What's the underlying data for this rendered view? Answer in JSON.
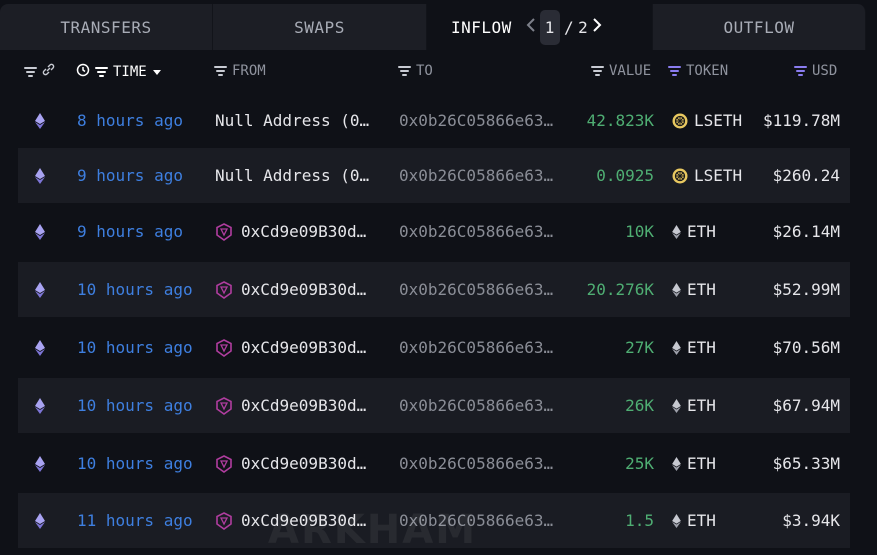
{
  "tabs": [
    {
      "label": "TRANSFERS"
    },
    {
      "label": "SWAPS"
    },
    {
      "label": "INFLOW"
    },
    {
      "label": "OUTFLOW"
    }
  ],
  "pager": {
    "current": "1",
    "separator": "/",
    "total": "2"
  },
  "columns": {
    "time": "TIME",
    "from": "FROM",
    "to": "TO",
    "value": "VALUE",
    "token": "TOKEN",
    "usd": "USD"
  },
  "rows": [
    {
      "time": "8 hours ago",
      "from": "Null Address (0…",
      "to": "0x0b26C05866e63…",
      "value": "42.823K",
      "token": "LSETH",
      "usd": "$119.78M"
    },
    {
      "time": "9 hours ago",
      "from": "Null Address (0…",
      "to": "0x0b26C05866e63…",
      "value": "0.0925",
      "token": "LSETH",
      "usd": "$260.24"
    },
    {
      "time": "9 hours ago",
      "from": "0xCd9e09B30d…",
      "to": "0x0b26C05866e63…",
      "value": "10K",
      "token": "ETH",
      "usd": "$26.14M"
    },
    {
      "time": "10 hours ago",
      "from": "0xCd9e09B30d…",
      "to": "0x0b26C05866e63…",
      "value": "20.276K",
      "token": "ETH",
      "usd": "$52.99M"
    },
    {
      "time": "10 hours ago",
      "from": "0xCd9e09B30d…",
      "to": "0x0b26C05866e63…",
      "value": "27K",
      "token": "ETH",
      "usd": "$70.56M"
    },
    {
      "time": "10 hours ago",
      "from": "0xCd9e09B30d…",
      "to": "0x0b26C05866e63…",
      "value": "26K",
      "token": "ETH",
      "usd": "$67.94M"
    },
    {
      "time": "10 hours ago",
      "from": "0xCd9e09B30d…",
      "to": "0x0b26C05866e63…",
      "value": "25K",
      "token": "ETH",
      "usd": "$65.33M"
    },
    {
      "time": "11 hours ago",
      "from": "0xCd9e09B30d…",
      "to": "0x0b26C05866e63…",
      "value": "1.5",
      "token": "ETH",
      "usd": "$3.94K"
    }
  ],
  "watermark": "ARKHAM",
  "icons": {
    "chain": "ethereum-icon",
    "from_entity": "contract-entity-icon",
    "lseth": "lseth-token-icon",
    "eth": "eth-token-icon"
  },
  "colors": {
    "background": "#0f1117",
    "row_alt": "#1a1c23",
    "time_link": "#3e7fe0",
    "value_green": "#4fae73",
    "accent_purple": "#8a7cf0",
    "lseth_gold": "#e8c860"
  }
}
